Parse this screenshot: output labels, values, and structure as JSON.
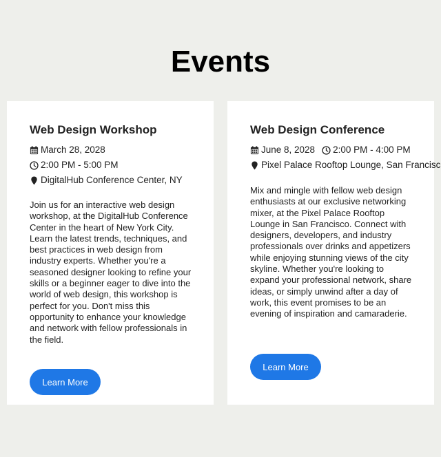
{
  "page": {
    "title": "Events"
  },
  "events": [
    {
      "title": "Web Design Workshop",
      "date": "March 28, 2028",
      "time": "2:00 PM - 5:00 PM",
      "location": "DigitalHub Conference Center, NY",
      "description": "Join us for an interactive web design workshop, at the DigitalHub Conference Center in the heart of New York City. Learn the latest trends, techniques, and best practices in web design from industry experts. Whether you're a seasoned designer looking to refine your skills or a beginner eager to dive into the world of web design, this workshop is perfect for you. Don't miss this opportunity to enhance your knowledge and network with fellow professionals in the field.",
      "button_label": "Learn More"
    },
    {
      "title": "Web Design Conference",
      "date": "June 8, 2028",
      "time": "2:00 PM - 4:00 PM",
      "location": "Pixel Palace Rooftop Lounge, San Francisco",
      "description": "Mix and mingle with fellow web design enthusiasts at our exclusive networking mixer, at the Pixel Palace Rooftop Lounge in San Francisco. Connect with designers, developers, and industry professionals over drinks and appetizers while enjoying stunning views of the city skyline. Whether you're looking to expand your professional network, share ideas, or simply unwind after a day of work, this event promises to be an evening of inspiration and camaraderie.",
      "button_label": "Learn More"
    }
  ],
  "colors": {
    "background": "#eeefeb",
    "card": "#ffffff",
    "button": "#1f78e6",
    "text": "#222222"
  },
  "icons": {
    "date": "calendar-icon",
    "time": "clock-icon",
    "location": "map-marker-icon"
  }
}
